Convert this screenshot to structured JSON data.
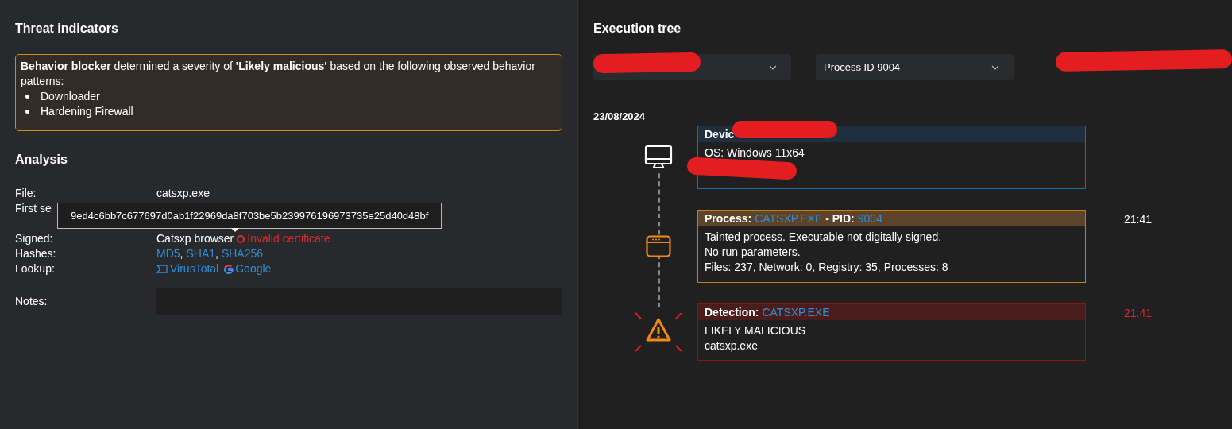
{
  "threat_indicators": {
    "title": "Threat indicators",
    "message": "**Behavior blocker** determined a severity of **'Likely malicious'** based on the following observed behavior patterns:",
    "patterns": [
      "Downloader",
      "Hardening Firewall"
    ]
  },
  "analysis": {
    "title": "Analysis",
    "rows": [
      {
        "kind": "text",
        "label": "File:",
        "value": "catsxp.exe"
      },
      {
        "kind": "text",
        "label": "First se"
      },
      {
        "kind": "signed",
        "label": "Signed:",
        "value": "Catsxp browser",
        "warning": "Invalid certificate"
      },
      {
        "kind": "links",
        "label": "Hashes:",
        "links": [
          "MD5",
          "SHA1",
          "SHA256"
        ],
        "separator": ","
      },
      {
        "kind": "lookup",
        "label": "Lookup:",
        "links": [
          "VirusTotal",
          "Google"
        ]
      }
    ],
    "notes": {
      "label": "Notes:"
    },
    "tooltip": "9ed4c6bb7c677697d0ab1f22969da8f703be5b239976196973735e25d40d48bf"
  },
  "execution_tree": {
    "title": "Execution tree",
    "filters": [
      {
        "kind": "redacted"
      },
      {
        "kind": "select",
        "value": "Process ID 9004"
      },
      {
        "kind": "redacted"
      }
    ],
    "date": "23/08/2024",
    "events": [
      {
        "kind": "device",
        "title": [
          {
            "text": "Devic",
            "link": false
          }
        ],
        "lines": [
          "OS: Windows 11x64"
        ],
        "redacted": true
      },
      {
        "kind": "process",
        "title": [
          {
            "text": "Process:",
            "link": false
          },
          {
            "text": "CATSXP.EXE",
            "link": true
          },
          {
            "text": "- PID:",
            "link": false
          },
          {
            "text": "9004",
            "link": true
          }
        ],
        "time": "21:41",
        "lines": [
          "Tainted process. Executable not digitally signed.",
          "No run parameters.",
          "Files: 237, Network: 0, Registry: 35, Processes: 8"
        ]
      },
      {
        "kind": "detection",
        "title": [
          {
            "text": "Detection:",
            "link": false
          },
          {
            "text": "CATSXP.EXE",
            "link": true
          }
        ],
        "time": "21:41",
        "lines": [
          "LIKELY MALICIOUS",
          "catsxp.exe"
        ]
      }
    ]
  }
}
